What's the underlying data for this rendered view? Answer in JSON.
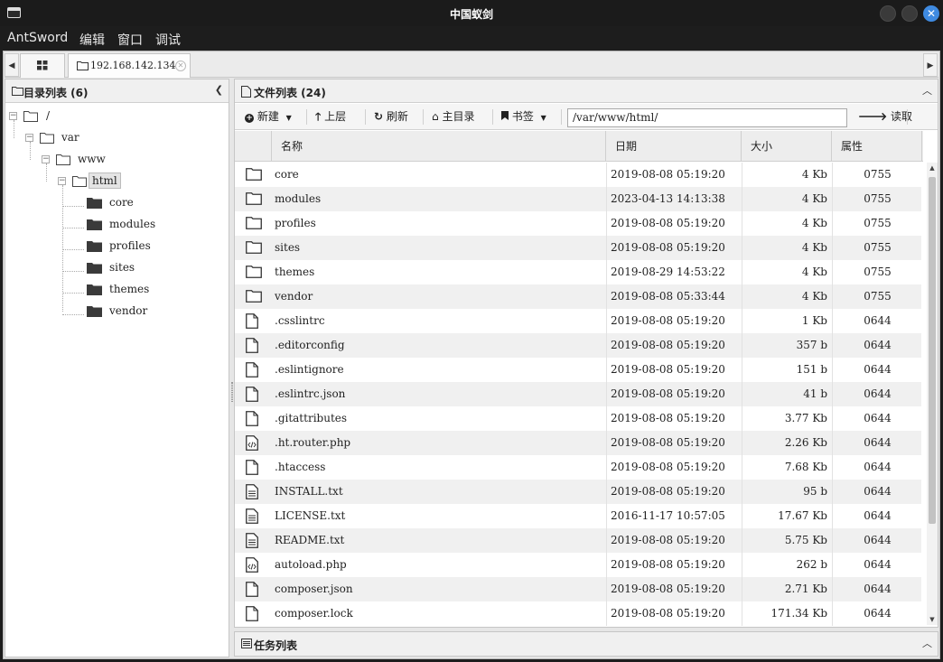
{
  "window": {
    "title": "中国蚁剑"
  },
  "menu": [
    "AntSword",
    "编辑",
    "窗口",
    "调试"
  ],
  "tabs": {
    "host_label": "192.168.142.134"
  },
  "dir_panel": {
    "title": "目录列表 (6)",
    "tree": [
      {
        "label": "/"
      },
      {
        "label": "var"
      },
      {
        "label": "www"
      },
      {
        "label": "html"
      },
      {
        "label": "core"
      },
      {
        "label": "modules"
      },
      {
        "label": "profiles"
      },
      {
        "label": "sites"
      },
      {
        "label": "themes"
      },
      {
        "label": "vendor"
      }
    ]
  },
  "file_panel": {
    "title": "文件列表 (24)",
    "toolbar": {
      "new": "新建",
      "up": "上层",
      "refresh": "刷新",
      "home": "主目录",
      "bookmark": "书签",
      "path": "/var/www/html/",
      "read": "读取"
    },
    "columns": [
      "名称",
      "日期",
      "大小",
      "属性"
    ],
    "rows": [
      {
        "icon": "folder-icon",
        "name": "core",
        "date": "2019-08-08 05:19:20",
        "size": "4 Kb",
        "attr": "0755"
      },
      {
        "icon": "folder-icon",
        "name": "modules",
        "date": "2023-04-13 14:13:38",
        "size": "4 Kb",
        "attr": "0755"
      },
      {
        "icon": "folder-icon",
        "name": "profiles",
        "date": "2019-08-08 05:19:20",
        "size": "4 Kb",
        "attr": "0755"
      },
      {
        "icon": "folder-icon",
        "name": "sites",
        "date": "2019-08-08 05:19:20",
        "size": "4 Kb",
        "attr": "0755"
      },
      {
        "icon": "folder-icon",
        "name": "themes",
        "date": "2019-08-29 14:53:22",
        "size": "4 Kb",
        "attr": "0755"
      },
      {
        "icon": "folder-icon",
        "name": "vendor",
        "date": "2019-08-08 05:33:44",
        "size": "4 Kb",
        "attr": "0755"
      },
      {
        "icon": "file-icon",
        "name": ".csslintrc",
        "date": "2019-08-08 05:19:20",
        "size": "1 Kb",
        "attr": "0644"
      },
      {
        "icon": "file-icon",
        "name": ".editorconfig",
        "date": "2019-08-08 05:19:20",
        "size": "357 b",
        "attr": "0644"
      },
      {
        "icon": "file-icon",
        "name": ".eslintignore",
        "date": "2019-08-08 05:19:20",
        "size": "151 b",
        "attr": "0644"
      },
      {
        "icon": "file-icon",
        "name": ".eslintrc.json",
        "date": "2019-08-08 05:19:20",
        "size": "41 b",
        "attr": "0644"
      },
      {
        "icon": "file-icon",
        "name": ".gitattributes",
        "date": "2019-08-08 05:19:20",
        "size": "3.77 Kb",
        "attr": "0644"
      },
      {
        "icon": "code-file-icon",
        "name": ".ht.router.php",
        "date": "2019-08-08 05:19:20",
        "size": "2.26 Kb",
        "attr": "0644"
      },
      {
        "icon": "file-icon",
        "name": ".htaccess",
        "date": "2019-08-08 05:19:20",
        "size": "7.68 Kb",
        "attr": "0644"
      },
      {
        "icon": "text-file-icon",
        "name": "INSTALL.txt",
        "date": "2019-08-08 05:19:20",
        "size": "95 b",
        "attr": "0644"
      },
      {
        "icon": "text-file-icon",
        "name": "LICENSE.txt",
        "date": "2016-11-17 10:57:05",
        "size": "17.67 Kb",
        "attr": "0644"
      },
      {
        "icon": "text-file-icon",
        "name": "README.txt",
        "date": "2019-08-08 05:19:20",
        "size": "5.75 Kb",
        "attr": "0644"
      },
      {
        "icon": "code-file-icon",
        "name": "autoload.php",
        "date": "2019-08-08 05:19:20",
        "size": "262 b",
        "attr": "0644"
      },
      {
        "icon": "file-icon",
        "name": "composer.json",
        "date": "2019-08-08 05:19:20",
        "size": "2.71 Kb",
        "attr": "0644"
      },
      {
        "icon": "file-icon",
        "name": "composer.lock",
        "date": "2019-08-08 05:19:20",
        "size": "171.34 Kb",
        "attr": "0644"
      }
    ]
  },
  "task_panel": {
    "title": "任务列表"
  }
}
